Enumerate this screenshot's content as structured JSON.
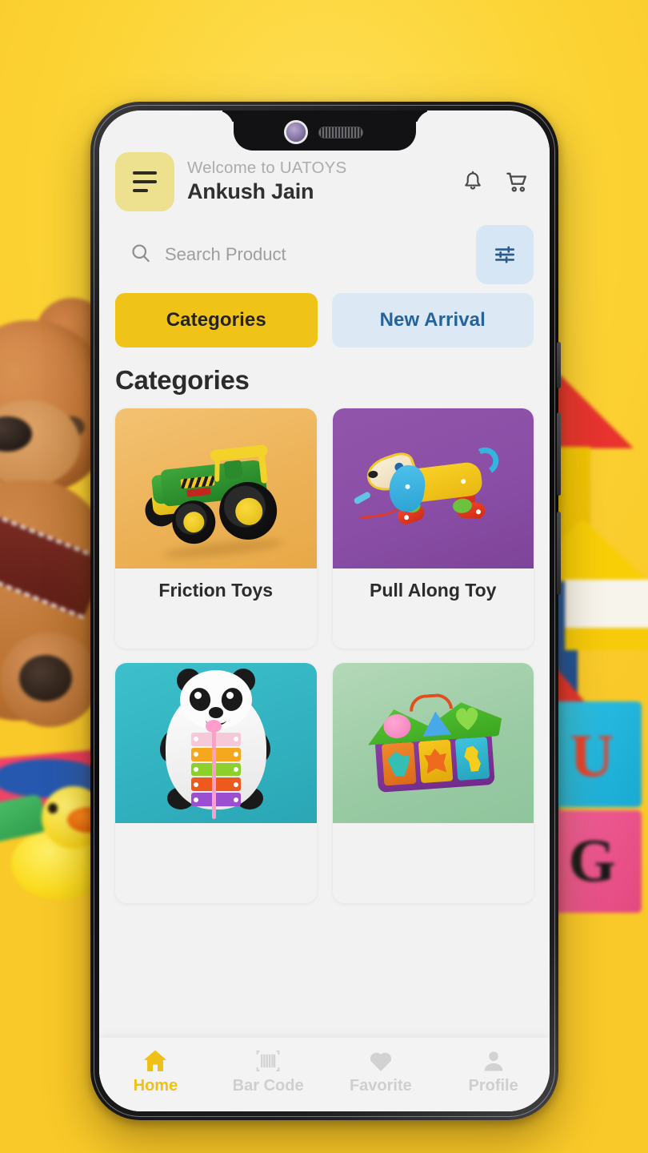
{
  "background": {
    "color": "#FCD634",
    "scene_items": [
      "teddy-bear",
      "rubber-duck",
      "alphabet-blocks"
    ],
    "block_letters": [
      "U",
      "G"
    ]
  },
  "phone": {
    "frame_color": "#1a1a1c",
    "screen_bg": "#F2F2F2",
    "notch": {
      "camera": "front-camera",
      "speaker": "earpiece-speaker"
    }
  },
  "header": {
    "menu_icon": "hamburger-menu-icon",
    "menu_bg": "#EDE08F",
    "welcome": "Welcome to UATOYS",
    "username": "Ankush Jain",
    "icons": [
      {
        "name": "notification-bell-icon"
      },
      {
        "name": "shopping-cart-icon"
      }
    ]
  },
  "search": {
    "icon": "search-icon",
    "placeholder": "Search Product",
    "value": "",
    "filter_icon": "filter-sliders-icon",
    "filter_bg": "#D7E6F4",
    "filter_color": "#2E5C8A"
  },
  "tabs": [
    {
      "label": "Categories",
      "active": true,
      "bg": "#EFC317",
      "color": "#26231A"
    },
    {
      "label": "New Arrival",
      "active": false,
      "bg": "#DCE9F5",
      "color": "#24639C"
    }
  ],
  "section": {
    "title": "Categories"
  },
  "categories": [
    {
      "label": "Friction Toys",
      "bg": "#F0B860",
      "toy": "tractor-toy"
    },
    {
      "label": "Pull Along Toy",
      "bg": "#8B4FA8",
      "toy": "pull-along-dog-toy"
    },
    {
      "label": "",
      "bg": "#35B6C4",
      "toy": "panda-xylophone-toy"
    },
    {
      "label": "",
      "bg": "#9BCBA4",
      "toy": "shape-sorter-house-toy"
    }
  ],
  "bottom_nav": [
    {
      "label": "Home",
      "icon": "home-icon",
      "active": true
    },
    {
      "label": "Bar Code",
      "icon": "barcode-icon",
      "active": false
    },
    {
      "label": "Favorite",
      "icon": "heart-icon",
      "active": false
    },
    {
      "label": "Profile",
      "icon": "person-icon",
      "active": false
    }
  ],
  "colors": {
    "accent_yellow": "#EFC317",
    "nav_active": "#EFC017",
    "nav_inactive": "#CFCFCF",
    "text_dark": "#2B2B2B",
    "text_muted": "#ACACAC"
  }
}
